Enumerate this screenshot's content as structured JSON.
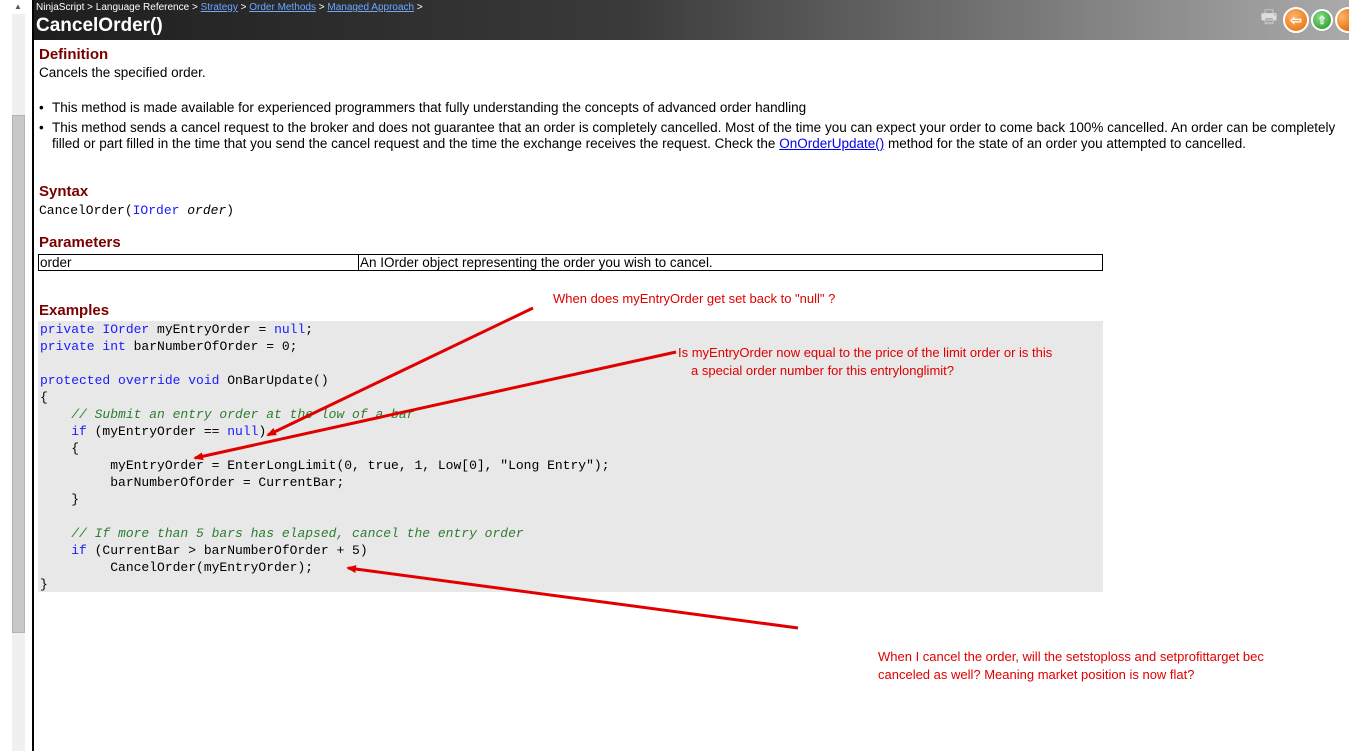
{
  "breadcrumb": {
    "items": [
      {
        "label": "NinjaScript",
        "link": false
      },
      {
        "label": "Language Reference",
        "link": false
      },
      {
        "label": "Strategy",
        "link": true
      },
      {
        "label": "Order Methods",
        "link": true
      },
      {
        "label": "Managed Approach",
        "link": true
      }
    ],
    "separator": ">"
  },
  "title": "CancelOrder()",
  "definition": {
    "heading": "Definition",
    "text": "Cancels the specified order."
  },
  "bullets": {
    "b1": "This method is made available for experienced programmers that fully understanding the concepts of advanced order handling",
    "b2_before": "This method sends a cancel request to the broker and does not guarantee that an order is completely cancelled. Most of the time you can expect your order to come back 100% cancelled. An order can be completely filled or part filled in the time that you send the cancel request and the time the exchange receives the request. Check the ",
    "b2_link": "OnOrderUpdate()",
    "b2_after": " method for the state of an order you attempted to cancelled."
  },
  "syntax": {
    "heading": "Syntax",
    "method": "CancelOrder(",
    "type": "IOrder",
    "param": "order",
    "close": ")"
  },
  "parameters": {
    "heading": "Parameters",
    "rows": [
      {
        "name": "order",
        "description": "An IOrder object representing the order you wish to cancel."
      }
    ]
  },
  "examples": {
    "heading": "Examples",
    "lines": {
      "l1_kw": "private",
      "l1_type": "IOrder",
      "l1_rest": " myEntryOrder = ",
      "l1_null": "null",
      "l1_end": ";",
      "l2_kw": "private",
      "l2_type": "int",
      "l2_rest": " barNumberOfOrder = 0;",
      "l4_kw": "protected override void",
      "l4_rest": " OnBarUpdate()",
      "l5": "{",
      "l6": "    // Submit an entry order at the low of a bar",
      "l7_kw": "    if",
      "l7_rest": " (myEntryOrder == ",
      "l7_null": "null",
      "l7_end": ")",
      "l8": "    {",
      "l9": "         myEntryOrder = EnterLongLimit(0, true, 1, Low[0], \"Long Entry\");",
      "l10": "         barNumberOfOrder = CurrentBar;",
      "l11": "    }",
      "l13": "    // If more than 5 bars has elapsed, cancel the entry order",
      "l14_kw": "    if",
      "l14_rest": " (CurrentBar > barNumberOfOrder + 5)",
      "l15": "         CancelOrder(myEntryOrder);",
      "l16": "}"
    }
  },
  "annotations": {
    "a1": "When does myEntryOrder get set back to \"null\" ?",
    "a2_line1": "Is myEntryOrder now equal to the price of the limit order or is this",
    "a2_line2": "a special order number for this entrylonglimit?",
    "a3_line1": "When I cancel the order, will the setstoploss and setprofittarget bec",
    "a3_line2": "canceled as well? Meaning market position is now flat?"
  },
  "colors": {
    "heading": "#7a0000",
    "keyword": "#1a1aff",
    "comment": "#2e7d32",
    "annotation": "#e00000",
    "code_bg": "#e8e8e8"
  },
  "icons": [
    "printer-icon",
    "back-arrow-icon",
    "up-arrow-icon",
    "next-icon"
  ]
}
